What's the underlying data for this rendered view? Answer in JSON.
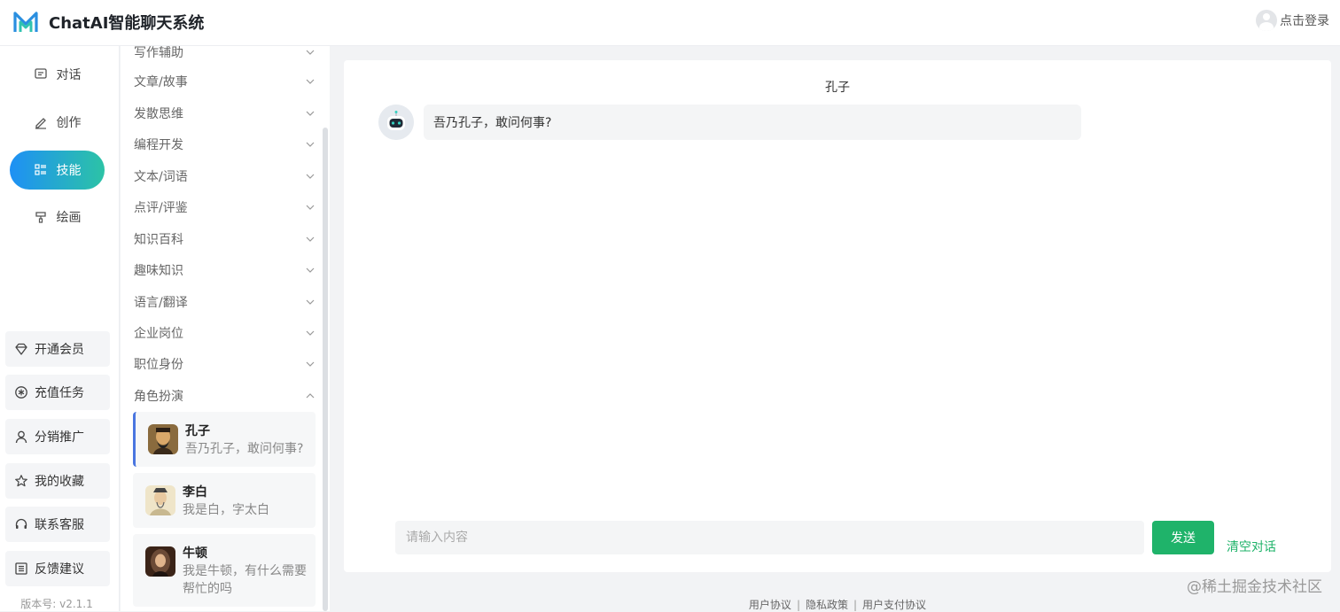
{
  "app": {
    "title": "ChatAI智能聊天系统",
    "login_label": "点击登录"
  },
  "leftnav": {
    "items": [
      {
        "label": "对话",
        "icon": "message-icon"
      },
      {
        "label": "创作",
        "icon": "pencil-icon"
      },
      {
        "label": "技能",
        "icon": "list-icon",
        "active": true
      },
      {
        "label": "绘画",
        "icon": "brush-icon"
      }
    ],
    "utilities": [
      {
        "label": "开通会员",
        "icon": "diamond-icon"
      },
      {
        "label": "充值任务",
        "icon": "asterisk-icon"
      },
      {
        "label": "分销推广",
        "icon": "user-icon"
      },
      {
        "label": "我的收藏",
        "icon": "star-icon"
      },
      {
        "label": "联系客服",
        "icon": "headset-icon"
      },
      {
        "label": "反馈建议",
        "icon": "form-icon"
      }
    ],
    "version": "版本号: v2.1.1"
  },
  "categories": {
    "items": [
      {
        "label": "写作辅助",
        "expanded": false
      },
      {
        "label": "文章/故事",
        "expanded": false
      },
      {
        "label": "发散思维",
        "expanded": false
      },
      {
        "label": "编程开发",
        "expanded": false
      },
      {
        "label": "文本/词语",
        "expanded": false
      },
      {
        "label": "点评/评鉴",
        "expanded": false
      },
      {
        "label": "知识百科",
        "expanded": false
      },
      {
        "label": "趣味知识",
        "expanded": false
      },
      {
        "label": "语言/翻译",
        "expanded": false
      },
      {
        "label": "企业岗位",
        "expanded": false
      },
      {
        "label": "职位身份",
        "expanded": false
      },
      {
        "label": "角色扮演",
        "expanded": true
      }
    ],
    "roles": [
      {
        "name": "孔子",
        "desc": "吾乃孔子，敢问何事?",
        "selected": true
      },
      {
        "name": "李白",
        "desc": "我是白，字太白",
        "selected": false
      },
      {
        "name": "牛顿",
        "desc": "我是牛顿，有什么需要帮忙的吗",
        "selected": false
      }
    ]
  },
  "chat": {
    "title": "孔子",
    "messages": [
      {
        "role": "assistant",
        "text": "吾乃孔子，敢问何事?"
      }
    ],
    "input_placeholder": "请输入内容",
    "send_label": "发送",
    "clear_label": "清空对话"
  },
  "footer": {
    "links": [
      "用户协议",
      "隐私政策",
      "用户支付协议"
    ]
  },
  "watermark": "@稀土掘金技术社区",
  "colors": {
    "accent_green": "#1fb36a",
    "nav_active_start": "#1e90f5",
    "nav_active_end": "#2cc3a6",
    "selected_border": "#4a76e0"
  }
}
